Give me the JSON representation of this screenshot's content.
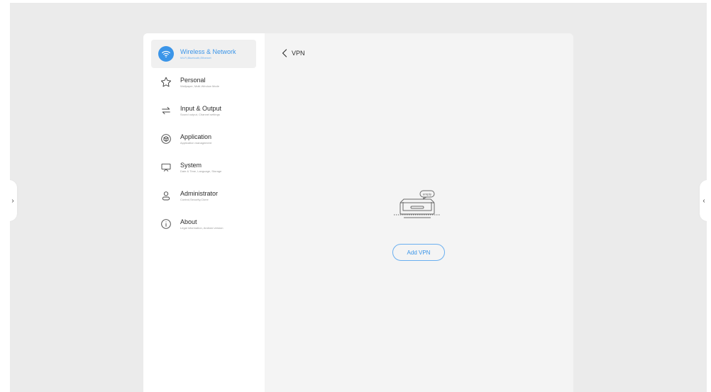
{
  "sidebar": {
    "items": [
      {
        "title": "Wireless & Network",
        "subtitle": "Wi-Fi,Bluetooth,Ethernet",
        "icon": "wifi-icon",
        "active": true
      },
      {
        "title": "Personal",
        "subtitle": "Wallpaper, Multi-Window Mode",
        "icon": "star-icon",
        "active": false
      },
      {
        "title": "Input & Output",
        "subtitle": "Sound output, Channel settings",
        "icon": "swap-arrows-icon",
        "active": false
      },
      {
        "title": "Application",
        "subtitle": "Application management",
        "icon": "application-icon",
        "active": false
      },
      {
        "title": "System",
        "subtitle": "Date & Time, Language, Storage",
        "icon": "monitor-icon",
        "active": false
      },
      {
        "title": "Administrator",
        "subtitle": "Control,Security,Clone",
        "icon": "person-icon",
        "active": false
      },
      {
        "title": "About",
        "subtitle": "Legal information, Android version",
        "icon": "info-icon",
        "active": false
      }
    ]
  },
  "content": {
    "page_title": "VPN",
    "empty_label": "empty",
    "add_button_label": "Add VPN"
  },
  "edges": {
    "left_glyph": "›",
    "right_glyph": "‹"
  },
  "colors": {
    "accent": "#3b95e8",
    "background": "#ebebeb",
    "panel": "#f4f4f4"
  }
}
